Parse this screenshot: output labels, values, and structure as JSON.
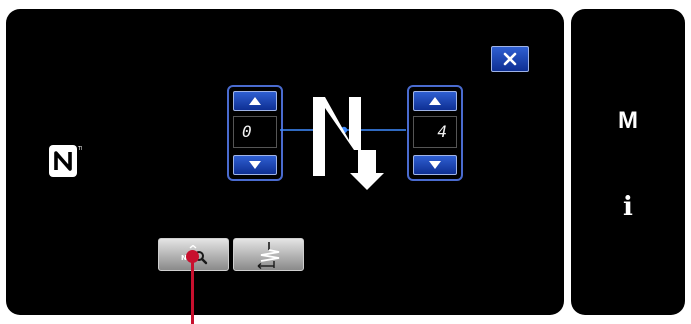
{
  "stitch": {
    "left_count": "0",
    "right_count": "4"
  },
  "side_panel": {
    "mode_label": "M",
    "info_label": "i"
  },
  "icons": {
    "close": "close-icon",
    "nfc": "nfc-icon",
    "up": "arrow-up-icon",
    "down": "arrow-down-icon",
    "search": "number-search-icon",
    "stitch": "stitch-pattern-icon"
  },
  "colors": {
    "panel": "#000000",
    "button_blue": "#1c45b8",
    "button_gray": "#b8b8b8",
    "pointer": "#c8102e"
  }
}
